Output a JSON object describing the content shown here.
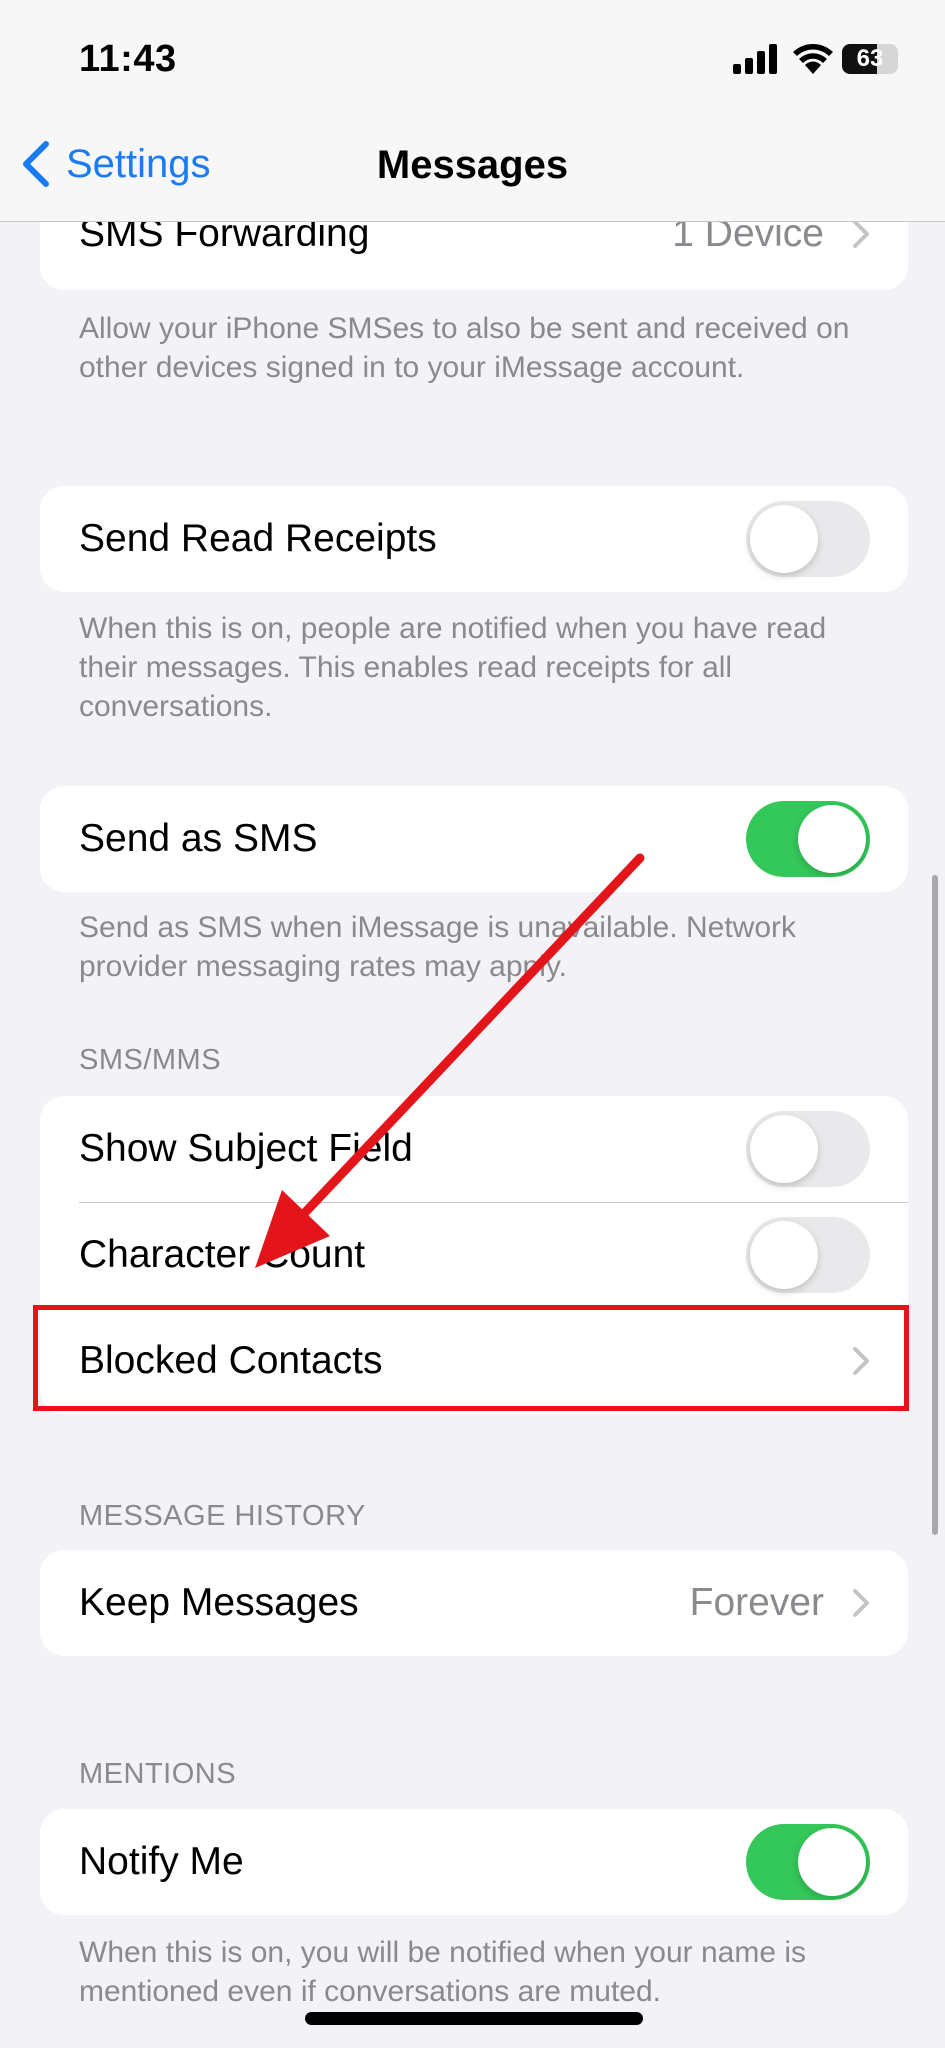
{
  "status_bar": {
    "time": "11:43",
    "battery": "63"
  },
  "nav": {
    "back_label": "Settings",
    "title": "Messages"
  },
  "sms_forwarding": {
    "label": "SMS Forwarding",
    "value": "1 Device"
  },
  "sms_forwarding_footer": "Allow your iPhone SMSes to also be sent and received on other devices signed in to your iMessage account.",
  "read_receipts": {
    "label": "Send Read Receipts",
    "enabled": false
  },
  "read_receipts_footer": "When this is on, people are notified when you have read their messages. This enables read receipts for all conversations.",
  "send_as_sms": {
    "label": "Send as SMS",
    "enabled": true
  },
  "send_as_sms_footer": "Send as SMS when iMessage is unavailable. Network provider messaging rates may apply.",
  "sms_mms": {
    "header": "SMS/MMS",
    "show_subject": {
      "label": "Show Subject Field",
      "enabled": false
    },
    "character_count": {
      "label": "Character Count",
      "enabled": false
    },
    "blocked_contacts": {
      "label": "Blocked Contacts"
    }
  },
  "message_history": {
    "header": "MESSAGE HISTORY",
    "keep_messages": {
      "label": "Keep Messages",
      "value": "Forever"
    }
  },
  "mentions": {
    "header": "MENTIONS",
    "notify_me": {
      "label": "Notify Me",
      "enabled": true
    },
    "footer": "When this is on, you will be notified when your name is mentioned even if conversations are muted."
  },
  "colors": {
    "accent": "#1a7cf5",
    "toggle_on": "#34c759",
    "annotation": "#e3151b"
  },
  "icons": [
    "signal-icon",
    "wifi-icon",
    "battery-icon",
    "back-chevron-icon",
    "chevron-right-icon"
  ]
}
